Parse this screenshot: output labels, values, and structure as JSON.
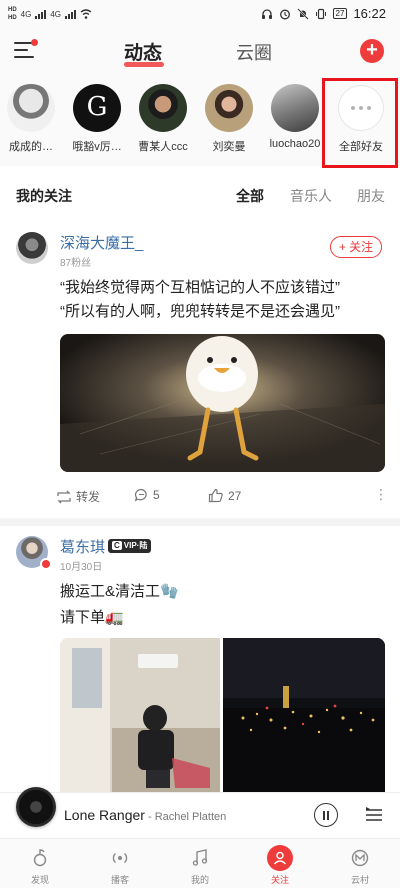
{
  "status_bar": {
    "hd_label_1": "HD",
    "hd_label_2": "HD",
    "network_1": "4G",
    "network_2": "4G",
    "battery": "27",
    "time": "16:22"
  },
  "header": {
    "tab_active": "动态",
    "tab_other": "云圈",
    "accent_color": "#ee3b3b"
  },
  "friends": [
    {
      "name": "成成的…"
    },
    {
      "name": "哦豁v厉…",
      "avatar_glyph": "G"
    },
    {
      "name": "曹某人ccc"
    },
    {
      "name": "刘奕曼"
    },
    {
      "name": "luochao20"
    },
    {
      "name": "全部好友"
    }
  ],
  "follow_section": {
    "title": "我的关注",
    "tabs": [
      "全部",
      "音乐人",
      "朋友"
    ],
    "active_tab": "全部"
  },
  "post1": {
    "user": "深海大魔王_",
    "subtitle": "87粉丝",
    "follow_label": "+ 关注",
    "line1": "“我始终觉得两个互相惦记的人不应该错过”",
    "line2": "“所以有的人啊，兜兜转转是不是还会遇见”",
    "repost_label": "转发",
    "comment_count": "5",
    "like_count": "27"
  },
  "post2": {
    "user": "葛东琪",
    "vip_label": "VIP·陆",
    "vip_mark": "C",
    "date": "10月30日",
    "line1": "搬运工&清洁工🧤",
    "line2": "请下单🚛"
  },
  "player": {
    "song": "Lone Ranger",
    "separator": " - ",
    "artist": "Rachel Platten"
  },
  "bottom_nav": [
    "发现",
    "播客",
    "我的",
    "关注",
    "云村"
  ],
  "bottom_nav_active": "关注"
}
